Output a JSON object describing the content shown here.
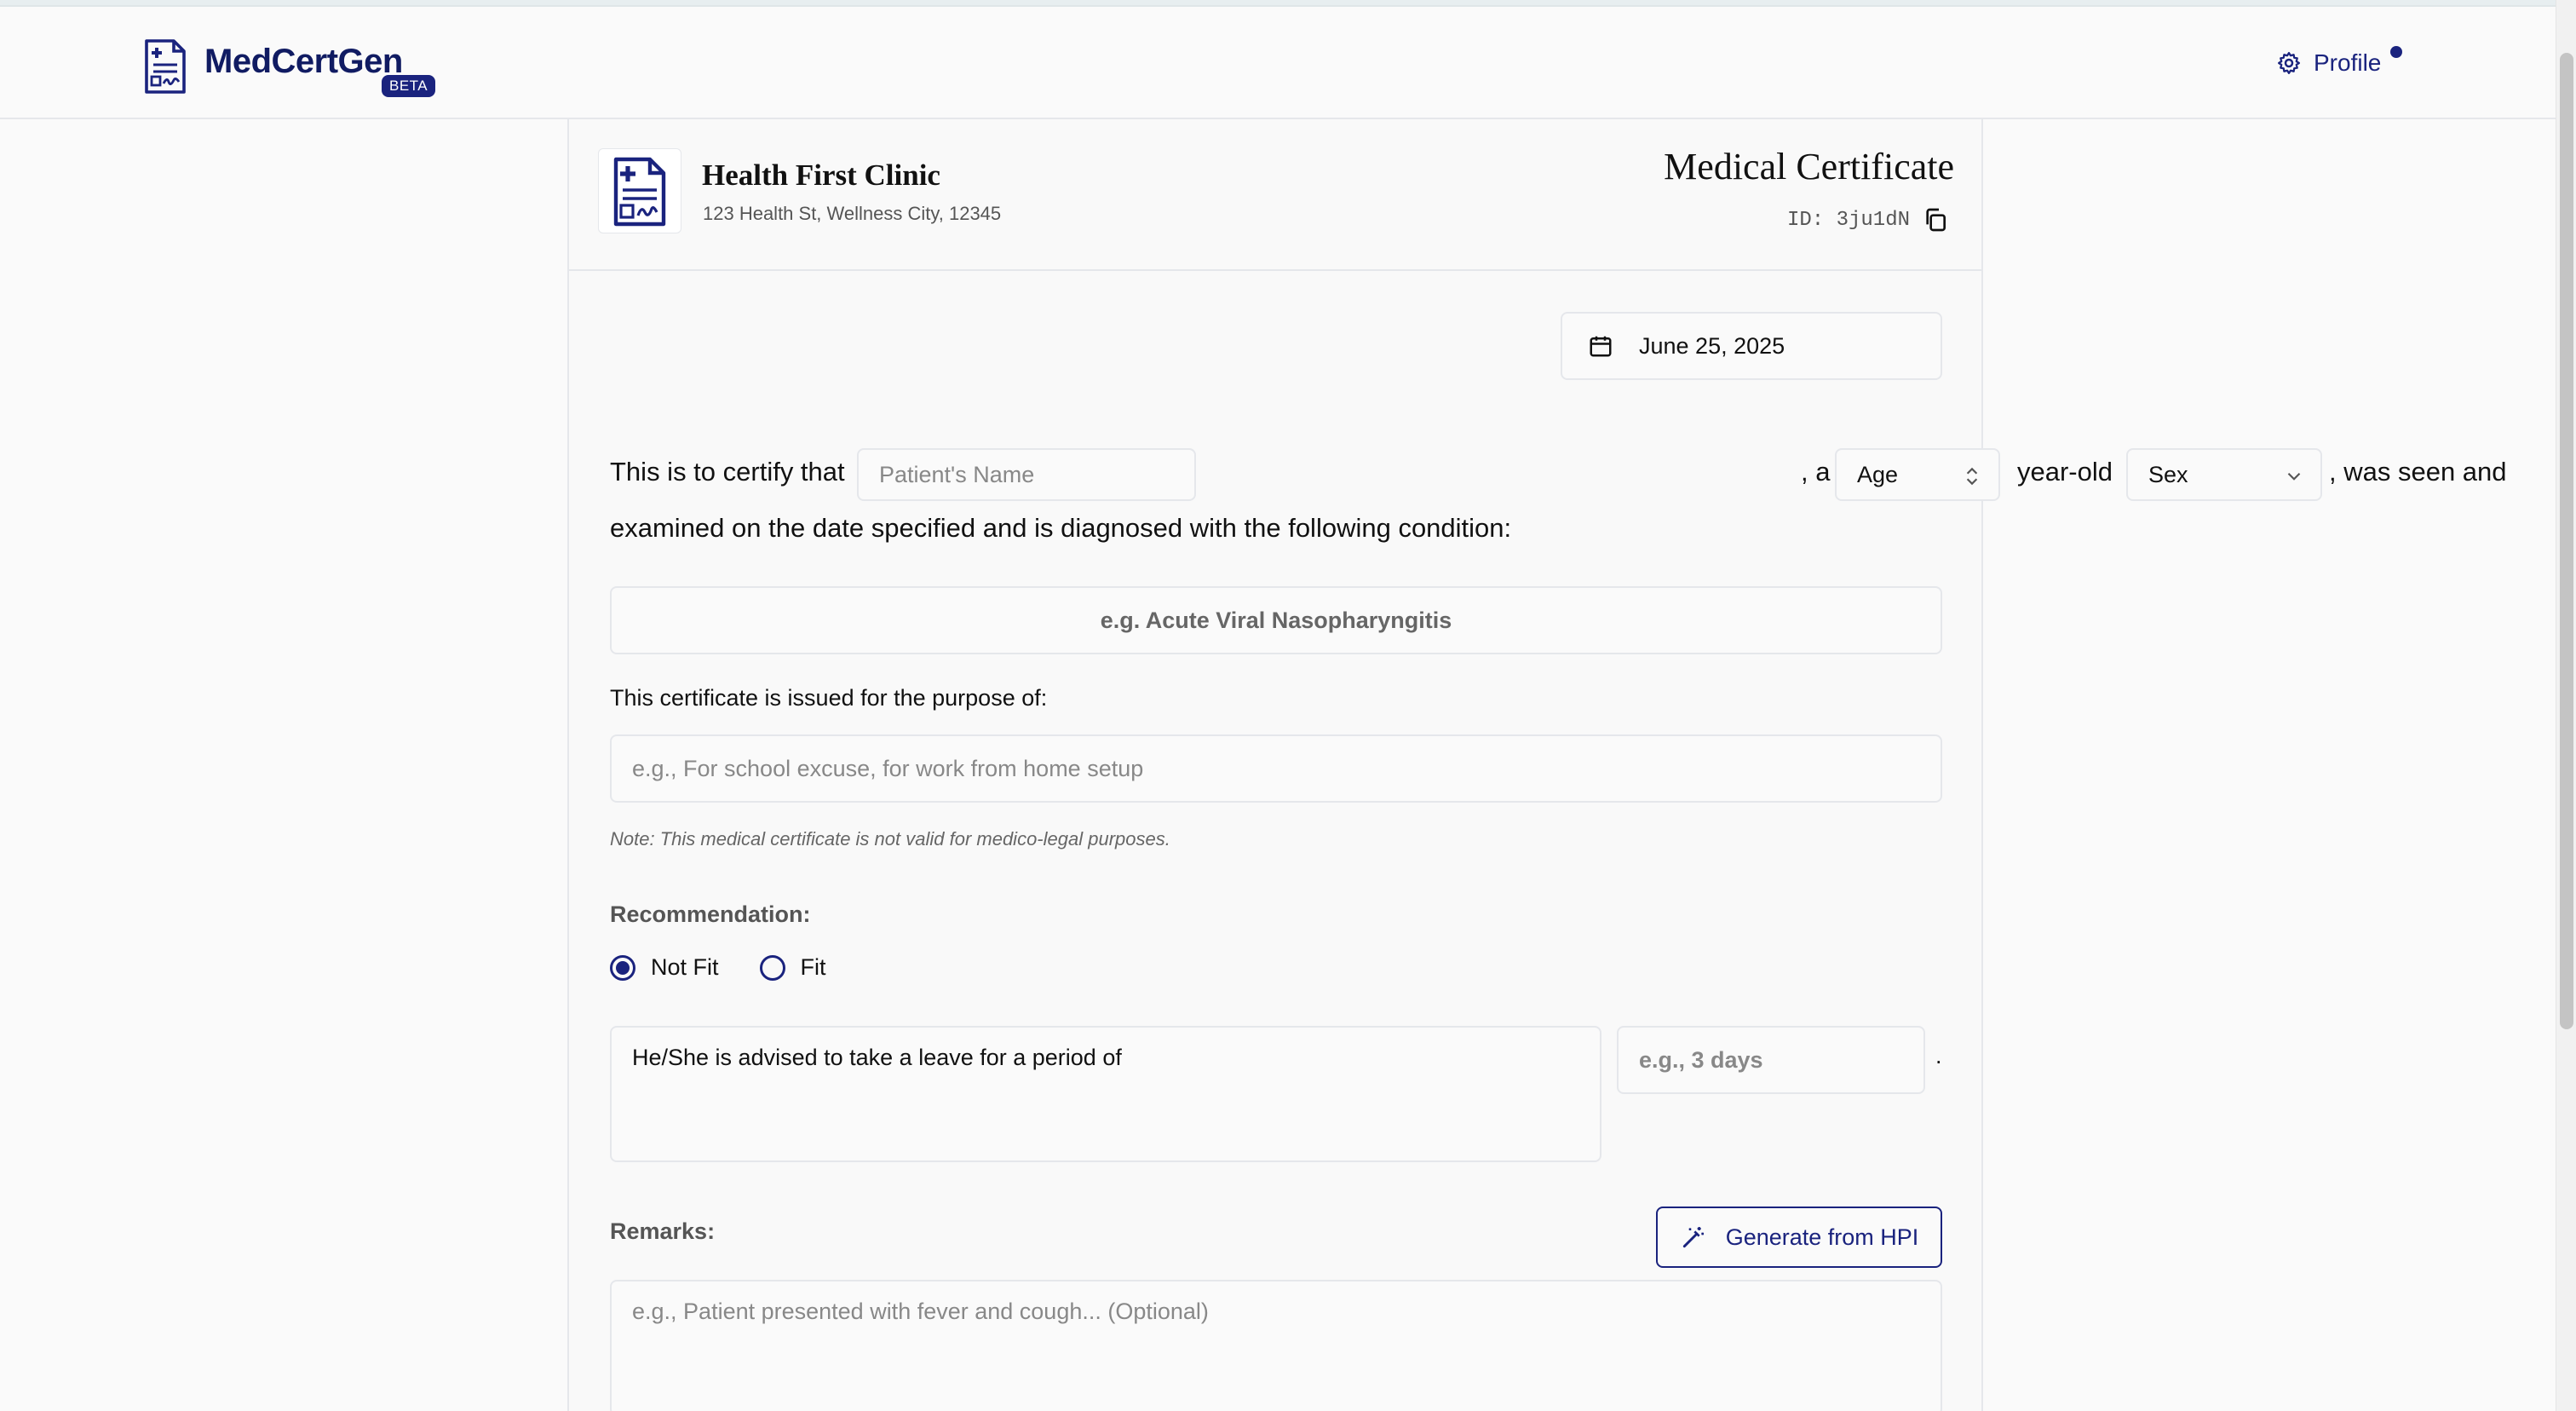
{
  "app": {
    "brand": "MedCertGen",
    "badge": "BETA",
    "profile_label": "Profile"
  },
  "clinic": {
    "name": "Health First Clinic",
    "address": "123 Health St, Wellness City, 12345"
  },
  "document": {
    "title": "Medical Certificate",
    "id_label": "ID: 3ju1dN",
    "date": "June 25, 2025"
  },
  "certify": {
    "prefix": "This is to certify that",
    "name_placeholder": "Patient's Name",
    "comma_a": ", a",
    "age_value": "Age",
    "year_old": "year-old",
    "sex_value": "Sex",
    "suffix": ", was seen and",
    "line2": "examined on the date specified and is diagnosed with the following condition:"
  },
  "diagnosis_placeholder": "e.g. Acute Viral Nasopharyngitis",
  "purpose": {
    "label": "This certificate is issued for the purpose of:",
    "placeholder": "e.g., For school excuse, for work from home setup"
  },
  "note": "Note: This medical certificate is not valid for medico-legal purposes.",
  "recommendation": {
    "label": "Recommendation:",
    "options": [
      {
        "label": "Not Fit",
        "selected": true
      },
      {
        "label": "Fit",
        "selected": false
      }
    ],
    "advice_text": "He/She is advised to take a leave for a period of",
    "period_placeholder": "e.g., 3 days",
    "period_suffix": "."
  },
  "remarks": {
    "label": "Remarks:",
    "generate_button": "Generate from HPI",
    "placeholder": "e.g., Patient presented with fever and cough... (Optional)"
  },
  "colors": {
    "accent": "#1a237e",
    "border": "#e5e7eb",
    "background": "#fafafa"
  },
  "icons": {
    "logo": "document-medical-icon",
    "settings": "gear-icon",
    "copy": "copy-icon",
    "calendar": "calendar-icon",
    "stepper": "chevron-up-down-icon",
    "dropdown": "chevron-down-icon",
    "wand": "magic-wand-icon"
  }
}
